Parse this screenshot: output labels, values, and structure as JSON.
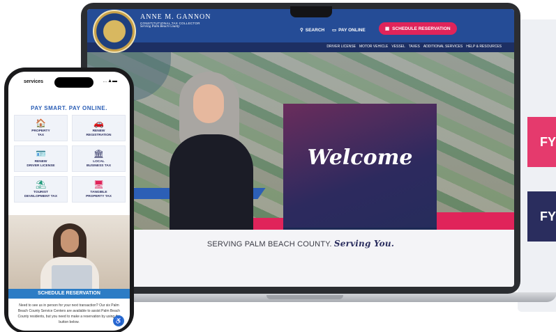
{
  "background_cards": {
    "card1": "FY",
    "card2": "FY"
  },
  "site": {
    "brand_name": "ANNE M. GANNON",
    "brand_subtitle": "CONSTITUTIONAL TAX COLLECTOR",
    "brand_tagline": "Serving Palm Beach County",
    "search_label": "SEARCH",
    "pay_online_label": "PAY ONLINE",
    "schedule_label": "SCHEDULE RESERVATION",
    "nav": [
      "DRIVER LICENSE",
      "MOTOR VEHICLE",
      "VESSEL",
      "TAXES",
      "ADDITIONAL SERVICES",
      "HELP & RESOURCES"
    ],
    "welcome_text": "Welcome",
    "carousel_active": "1",
    "tagline_plain": "SERVING PALM BEACH COUNTY.",
    "tagline_script": "Serving You."
  },
  "phone": {
    "status_label": "services",
    "status_icons": "…▲▬",
    "pay_title": "PAY SMART. PAY ONLINE.",
    "services": [
      {
        "icon": "🏠",
        "label": "PROPERTY\nTAX",
        "color": "#e0245a"
      },
      {
        "icon": "🚗",
        "label": "RENEW\nREGISTRATION",
        "color": "#1f9a7a"
      },
      {
        "icon": "🪪",
        "label": "RENEW\nDRIVER LICENSE",
        "color": "#e0245a"
      },
      {
        "icon": "🏛",
        "label": "LOCAL\nBUSINESS TAX",
        "color": "#2a2d5e"
      },
      {
        "icon": "⛱",
        "label": "TOURIST\nDEVELOPMENT TAX",
        "color": "#1f9a7a"
      },
      {
        "icon": "🖥",
        "label": "TANGIBLE\nPROPERTY TAX",
        "color": "#e0245a"
      }
    ],
    "schedule_label": "SCHEDULE RESERVATION",
    "schedule_text": "Need to see us in person for your next transaction? Our six Palm Beach County Service Centers are available to assist Palm Beach County residents, but you need to make a reservation by using the button below."
  },
  "colors": {
    "brand_blue": "#254c96",
    "accent_pink": "#e0245a",
    "navy": "#2a2d5e"
  }
}
